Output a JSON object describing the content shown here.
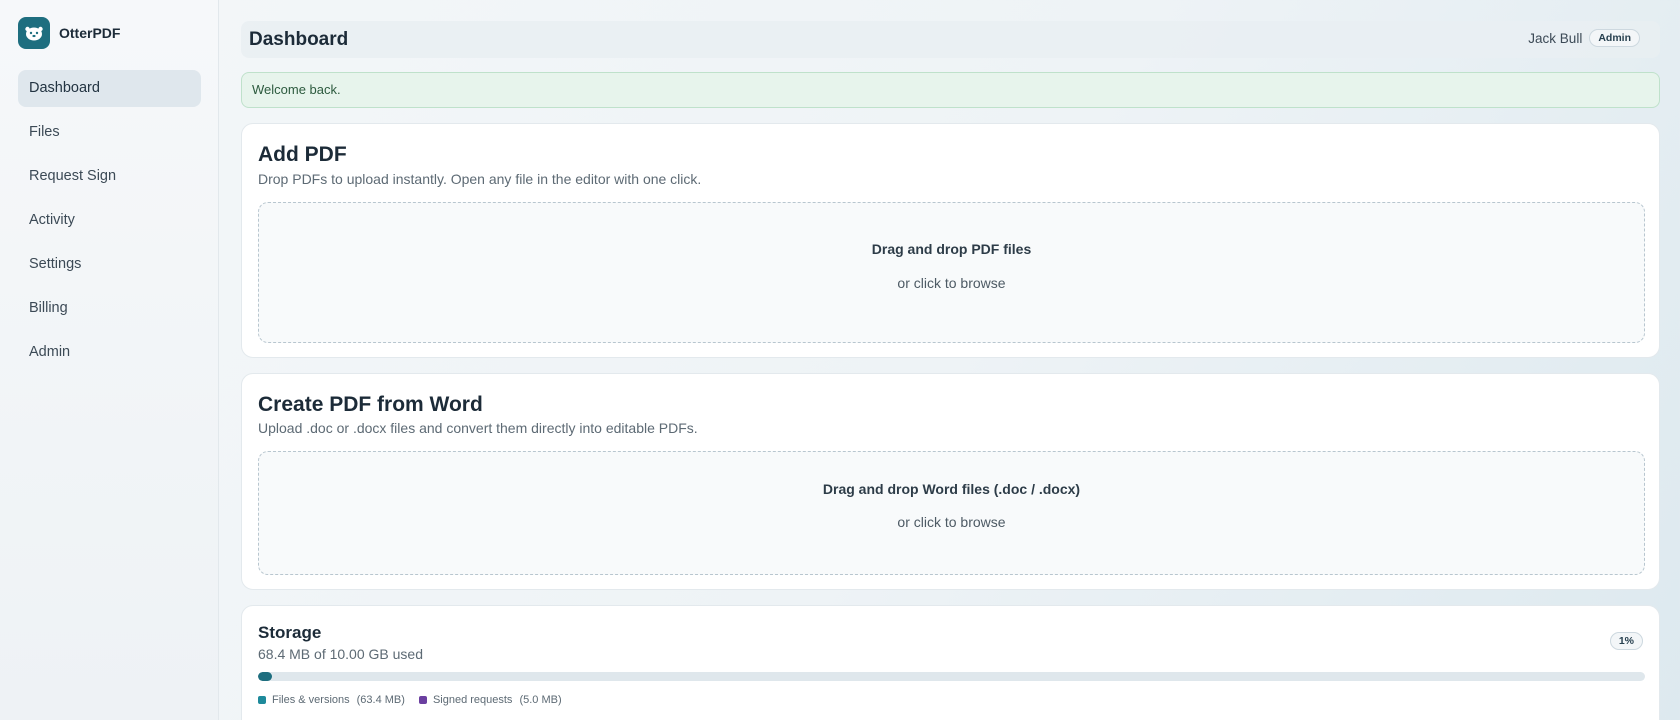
{
  "app": {
    "name": "OtterPDF",
    "logo_icon": "otter-icon"
  },
  "sidebar": {
    "items": [
      {
        "label": "Dashboard",
        "active": true
      },
      {
        "label": "Files"
      },
      {
        "label": "Request Sign"
      },
      {
        "label": "Activity"
      },
      {
        "label": "Settings"
      },
      {
        "label": "Billing"
      },
      {
        "label": "Admin"
      }
    ]
  },
  "header": {
    "title": "Dashboard",
    "user_name": "Jack Bull",
    "role_badge": "Admin"
  },
  "alert": {
    "message": "Welcome back."
  },
  "add_pdf": {
    "title": "Add PDF",
    "description": "Drop PDFs to upload instantly. Open any file in the editor with one click.",
    "dropzone_main": "Drag and drop PDF files",
    "dropzone_sub": "or click to browse"
  },
  "word_pdf": {
    "title": "Create PDF from Word",
    "description": "Upload .doc or .docx files and convert them directly into editable PDFs.",
    "dropzone_main": "Drag and drop Word files (.doc / .docx)",
    "dropzone_sub": "or click to browse"
  },
  "storage": {
    "title": "Storage",
    "used_text": "68.4 MB of 10.00 GB used",
    "percent_label": "1%",
    "fill_percent": 1,
    "legend": [
      {
        "label": "Files & versions",
        "size": "(63.4 MB)",
        "color": "#1e8a9b"
      },
      {
        "label": "Signed requests",
        "size": "(5.0 MB)",
        "color": "#6b3fa0"
      }
    ]
  },
  "colors": {
    "accent": "#1e6e7f",
    "success_bg": "#e7f4ec"
  }
}
